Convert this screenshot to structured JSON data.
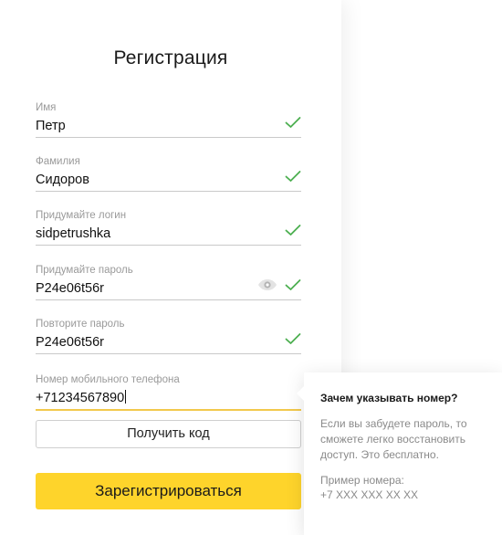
{
  "form": {
    "title": "Регистрация",
    "fields": [
      {
        "label": "Имя",
        "value": "Петр"
      },
      {
        "label": "Фамилия",
        "value": "Сидоров"
      },
      {
        "label": "Придумайте логин",
        "value": "sidpetrushka"
      },
      {
        "label": "Придумайте пароль",
        "value": "P24e06t56r"
      },
      {
        "label": "Повторите пароль",
        "value": "P24e06t56r"
      },
      {
        "label": "Номер мобильного телефона",
        "value": "+71234567890"
      }
    ],
    "get_code_button": "Получить код",
    "register_button": "Зарегистрироваться"
  },
  "tooltip": {
    "title": "Зачем указывать номер?",
    "body": "Если вы забудете пароль, то сможете легко восстановить доступ. Это бесплатно.",
    "example_label": "Пример номера:",
    "example_value": "+7 XXX XXX XX XX"
  },
  "colors": {
    "accent_yellow": "#fed42b",
    "check_green": "#4caf50",
    "label_gray": "#9a9a9a"
  },
  "icons": {
    "valid": "check-icon",
    "show_password": "eye-icon"
  }
}
